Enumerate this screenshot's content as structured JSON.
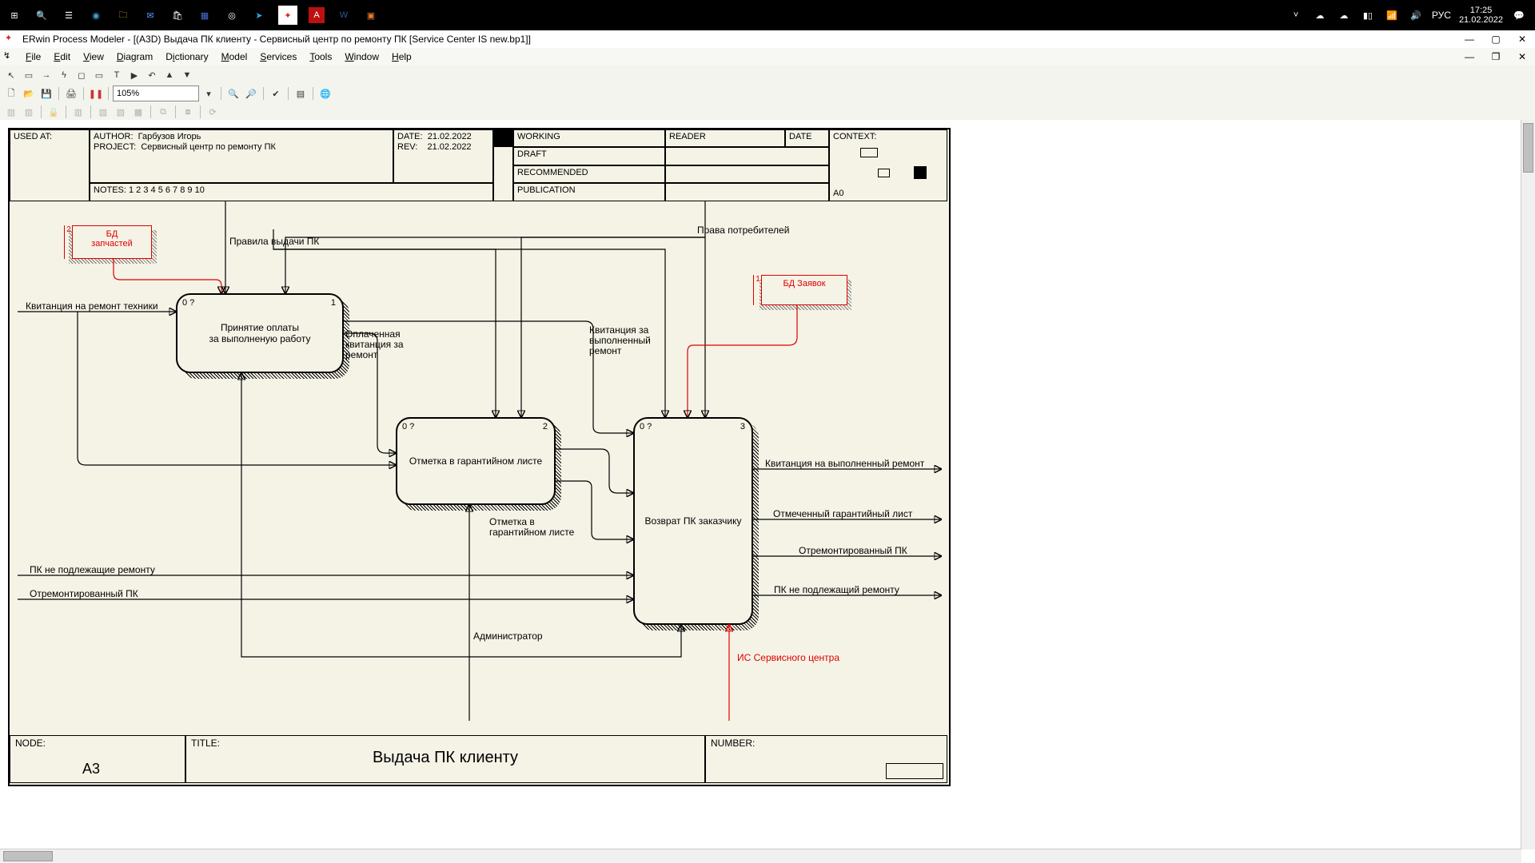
{
  "taskbar": {
    "lang": "РУС",
    "time": "17:25",
    "date": "21.02.2022"
  },
  "titlebar": {
    "text": "ERwin Process Modeler - [(A3D) Выдача ПК клиенту  - Сервисный центр по ремонту ПК  [Service Center IS new.bp1]]"
  },
  "menu": {
    "items": [
      "File",
      "Edit",
      "View",
      "Diagram",
      "Dictionary",
      "Model",
      "Services",
      "Tools",
      "Window",
      "Help"
    ]
  },
  "zoom": "105%",
  "sheet": {
    "used_at": "USED AT:",
    "author_label": "AUTHOR:",
    "author": "Гарбузов Игорь",
    "project_label": "PROJECT:",
    "project": "Сервисный центр по ремонту ПК",
    "date_label": "DATE:",
    "date": "21.02.2022",
    "rev_label": "REV:",
    "rev": "21.02.2022",
    "notes": "NOTES:  1  2  3  4  5  6  7  8  9  10",
    "status": [
      "WORKING",
      "DRAFT",
      "RECOMMENDED",
      "PUBLICATION"
    ],
    "reader": "READER",
    "reader_date": "DATE",
    "context": "CONTEXT:",
    "context_code": "A0",
    "node_label": "NODE:",
    "node": "A3",
    "title_label": "TITLE:",
    "title": "Выдача ПК клиенту",
    "number_label": "NUMBER:"
  },
  "datastores": {
    "ds1_num": "2",
    "ds1": "БД\nзапчастей",
    "ds2_num": "1",
    "ds2": "БД Заявок"
  },
  "activities": {
    "a1_idx": "0 ?",
    "a1_num": "1",
    "a1": "Принятие оплаты\nза выполненую работу",
    "a2_idx": "0 ?",
    "a2_num": "2",
    "a2": "Отметка в гарантийном листе",
    "a3_idx": "0 ?",
    "a3_num": "3",
    "a3": "Возврат ПК заказчику"
  },
  "labels": {
    "l_rules": "Правила выдачи ПК",
    "l_rights": "Права потребителей",
    "l_kvit_in": "Квитанция на ремонт техники",
    "l_paid": "Оплаченная\nквитанция за\nремонт",
    "l_kvit_done": "Квитанция за\nвыполненный\nремонт",
    "l_mark": "Отметка в\nгарантийном листе",
    "l_pc_no": "ПК не подлежащие ремонту",
    "l_pc_rep": "Отремонтированный ПК",
    "l_admin": "Администратор",
    "l_is": "ИС Сервисного центра",
    "o_kvit": "Квитанция на выполненный ремонт",
    "o_glist": "Отмеченный гарантийный лист",
    "o_pc_rep": "Отремонтированный ПК",
    "o_pc_no": "ПК не подлежащий ремонту"
  }
}
